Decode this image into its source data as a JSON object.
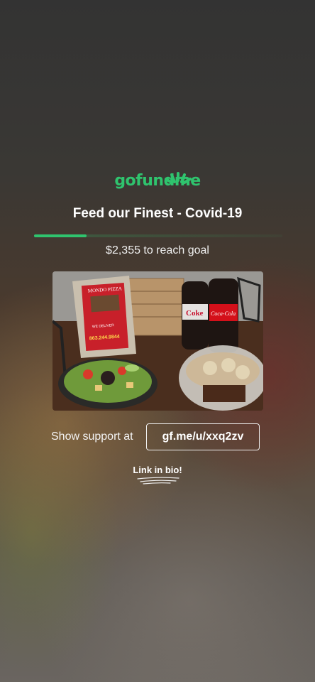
{
  "logo": {
    "text": "gofundme",
    "color": "#2fc46e",
    "icon": "gofundme-burst-icon"
  },
  "campaign": {
    "title": "Feed our Finest - Covid-19",
    "progress_fraction": 0.21,
    "goal_text": "$2,355 to reach goal"
  },
  "photo": {
    "flyer_lines": [
      "MONDO PIZZA",
      "WE DELIVER",
      "863.244.9844"
    ],
    "bottle_labels": [
      "Coke",
      "Coca-Cola"
    ]
  },
  "support": {
    "label": "Show support at",
    "link": "gf.me/u/xxq2zv"
  },
  "bio_link": "Link in bio!"
}
